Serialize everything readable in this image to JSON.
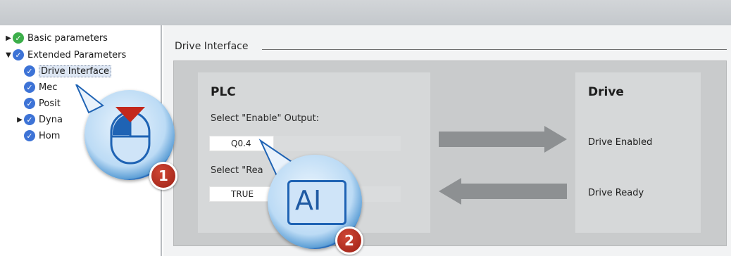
{
  "tree": {
    "items": [
      {
        "label": "Basic parameters",
        "status": "green-check",
        "expander": "collapsed"
      },
      {
        "label": "Extended Parameters",
        "status": "blue-check",
        "expander": "expanded"
      },
      {
        "label": "Drive Interface",
        "status": "blue-check",
        "selected": true
      },
      {
        "label": "Mec",
        "status": "blue-check"
      },
      {
        "label": "Posit",
        "status": "blue-check"
      },
      {
        "label": "Dyna",
        "status": "blue-check",
        "expander": "collapsed"
      },
      {
        "label": "Hom",
        "status": "blue-check"
      }
    ]
  },
  "main": {
    "section_title": "Drive Interface",
    "plc": {
      "heading": "PLC",
      "enable_label": "Select \"Enable\" Output:",
      "enable_value": "Q0.4",
      "ready_label": "Select \"Rea",
      "ready_value": "TRUE"
    },
    "drive": {
      "heading": "Drive",
      "enabled_label": "Drive Enabled",
      "ready_label": "Drive Ready"
    }
  },
  "callouts": {
    "step1": "1",
    "step2": "2",
    "text_cursor_glyph": "AI"
  },
  "colors": {
    "check_green": "#3cae4a",
    "check_blue": "#3d73d6",
    "badge_red": "#b3301f",
    "callout_blue": "#1f63b4"
  }
}
